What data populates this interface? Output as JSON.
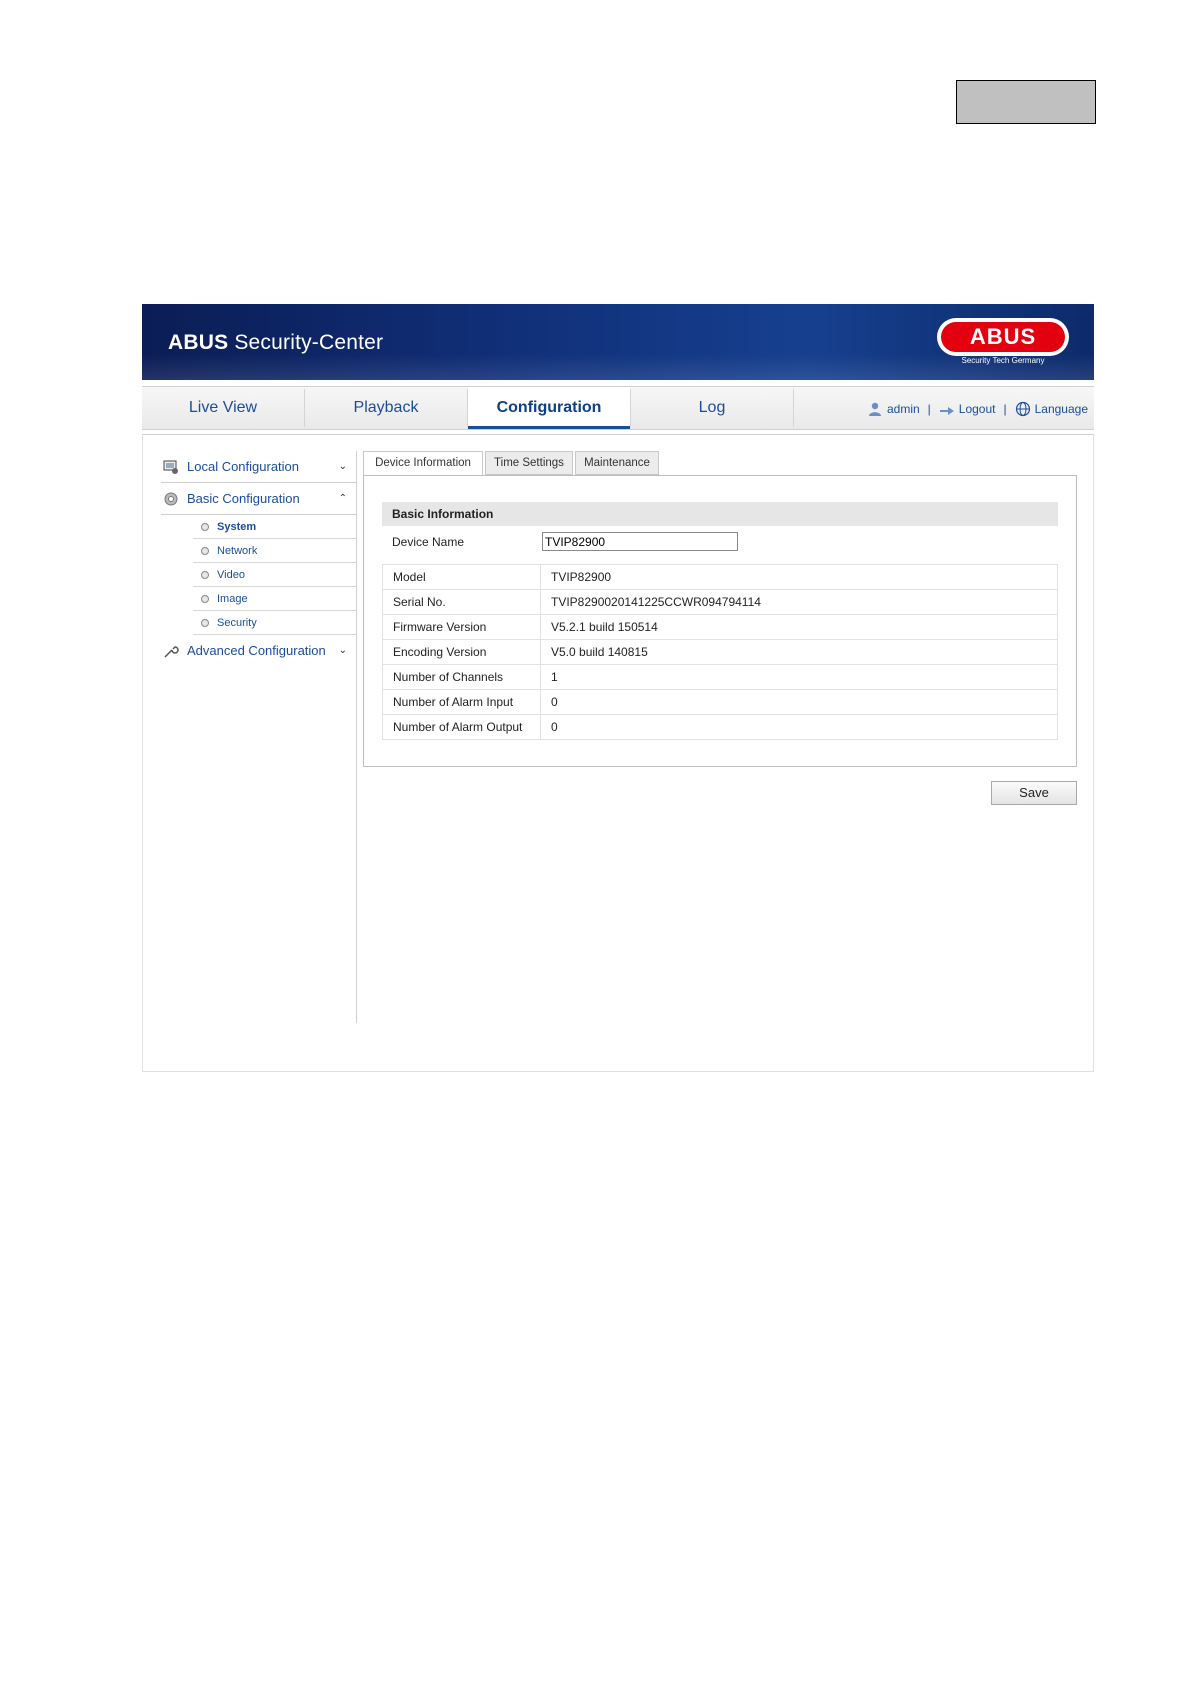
{
  "header": {
    "brand_bold": "ABUS",
    "brand_rest": " Security-Center",
    "logo_text": "ABUS",
    "logo_tagline": "Security Tech Germany",
    "banner_color": "#11307a",
    "logo_color": "#e3000f"
  },
  "nav": {
    "tabs": [
      {
        "label": "Live View",
        "active": false
      },
      {
        "label": "Playback",
        "active": false
      },
      {
        "label": "Configuration",
        "active": true
      },
      {
        "label": "Log",
        "active": false
      }
    ],
    "user_label": "admin",
    "logout_label": "Logout",
    "language_label": "Language",
    "separator": "|"
  },
  "sidebar": {
    "sections": [
      {
        "label": "Local Configuration",
        "icon": "local-config-icon",
        "expanded": false
      },
      {
        "label": "Basic Configuration",
        "icon": "gear-icon",
        "expanded": true
      },
      {
        "label": "Advanced Configuration",
        "icon": "wrench-icon",
        "expanded": false
      }
    ],
    "basic_items": [
      {
        "label": "System",
        "active": true
      },
      {
        "label": "Network",
        "active": false
      },
      {
        "label": "Video",
        "active": false
      },
      {
        "label": "Image",
        "active": false
      },
      {
        "label": "Security",
        "active": false
      }
    ]
  },
  "main": {
    "tabs": [
      {
        "label": "Device Information",
        "active": true
      },
      {
        "label": "Time Settings",
        "active": false
      },
      {
        "label": "Maintenance",
        "active": false
      }
    ],
    "section_title": "Basic Information",
    "device_name_label": "Device Name",
    "device_name_value": "TVIP82900",
    "info_rows": [
      {
        "key": "Model",
        "value": "TVIP82900"
      },
      {
        "key": "Serial No.",
        "value": "TVIP8290020141225CCWR094794114"
      },
      {
        "key": "Firmware Version",
        "value": "V5.2.1 build 150514"
      },
      {
        "key": "Encoding Version",
        "value": "V5.0 build 140815"
      },
      {
        "key": "Number of Channels",
        "value": "1"
      },
      {
        "key": "Number of Alarm Input",
        "value": "0"
      },
      {
        "key": "Number of Alarm Output",
        "value": "0"
      }
    ],
    "save_label": "Save"
  }
}
